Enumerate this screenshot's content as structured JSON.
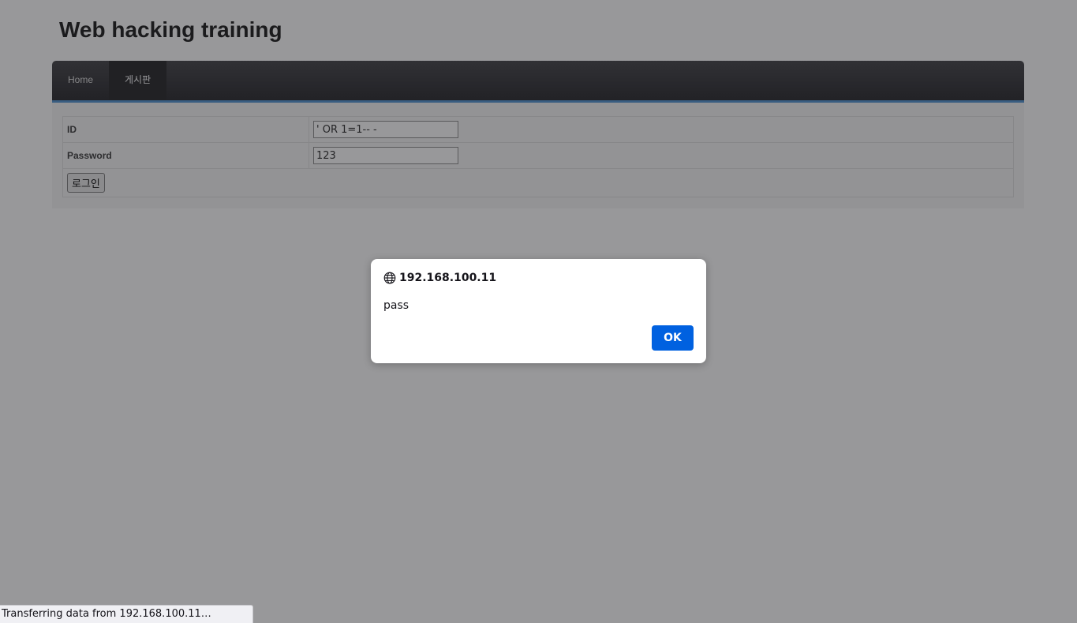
{
  "site": {
    "title": "Web hacking training"
  },
  "nav": {
    "items": [
      {
        "label": "Home"
      },
      {
        "label": "게시판"
      }
    ]
  },
  "login_form": {
    "id_label": "ID",
    "id_value": "' OR 1=1-- -",
    "password_label": "Password",
    "password_value": "123",
    "submit_label": "로그인"
  },
  "alert_dialog": {
    "origin": "192.168.100.11",
    "message": "pass",
    "ok_label": "OK",
    "icon": "globe-icon"
  },
  "status_bar": {
    "text": "Transferring data from 192.168.100.11…"
  },
  "colors": {
    "accent": "#0061e0",
    "nav_border": "#4a8fd0"
  }
}
